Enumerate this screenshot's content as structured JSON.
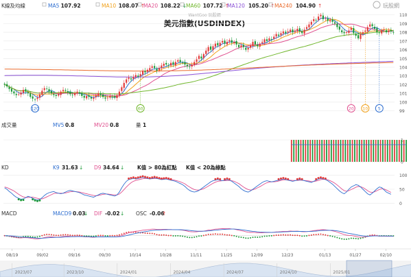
{
  "brand": {
    "text": "玩股網",
    "color": "#9b9b9b"
  },
  "title": "美元指數(USDINDEX)",
  "watermark": "WantGoo 玩股網",
  "legend": [
    {
      "label": "K線及均線",
      "value": "",
      "arrow": "",
      "color": "#333333"
    },
    {
      "label": "MA5",
      "value": "107.92",
      "arrow": "",
      "color": "#2f6fd0"
    },
    {
      "label": "MA10",
      "value": "108.07",
      "arrow": "↑",
      "color": "#f0a01a"
    },
    {
      "label": "MA20",
      "value": "108.22",
      "arrow": "↓",
      "color": "#e0508f"
    },
    {
      "label": "MA60",
      "value": "107.72",
      "arrow": "↑",
      "color": "#6fb62a"
    },
    {
      "label": "MA120",
      "value": "105.20",
      "arrow": "↑",
      "color": "#8a4fd6"
    },
    {
      "label": "MA240",
      "value": "104.90",
      "arrow": "↑",
      "color": "#ea6a2a"
    }
  ],
  "colors": {
    "up": "#e23b3b",
    "down": "#1f9a3a",
    "grid": "#e7e7e7",
    "axis": "#555555"
  },
  "chart_data": [
    {
      "id": "price",
      "type": "candlestick",
      "title": "美元指數(USDINDEX)",
      "yticks": [
        99,
        100,
        101,
        102,
        103,
        104,
        105,
        106,
        107,
        108,
        109,
        110
      ],
      "ylim": [
        98.5,
        110.6
      ],
      "closes": [
        102.0,
        101.8,
        101.5,
        101.2,
        101.0,
        100.8,
        100.9,
        101.1,
        101.4,
        101.2,
        101.0,
        100.6,
        100.4,
        100.3,
        100.5,
        100.9,
        101.3,
        101.6,
        101.5,
        101.2,
        101.0,
        100.8,
        100.7,
        100.9,
        101.2,
        101.4,
        101.3,
        101.1,
        100.9,
        100.8,
        101.0,
        101.2,
        101.0,
        100.7,
        100.5,
        100.7,
        100.6,
        100.4,
        100.5,
        100.8,
        101.0,
        100.8,
        100.6,
        100.4,
        100.5,
        100.7,
        100.6,
        100.5,
        100.8,
        101.2,
        101.7,
        102.2,
        102.6,
        102.8,
        102.6,
        102.9,
        103.1,
        102.9,
        103.2,
        103.6,
        103.4,
        103.7,
        103.9,
        104.1,
        103.9,
        103.6,
        103.9,
        104.2,
        104.4,
        104.3,
        104.2,
        104.5,
        104.3,
        104.6,
        104.8,
        104.6,
        104.5,
        104.3,
        104.1,
        104.0,
        104.3,
        104.6,
        104.9,
        105.3,
        105.0,
        105.5,
        105.9,
        106.3,
        106.0,
        106.4,
        106.7,
        106.5,
        106.8,
        107.0,
        106.7,
        106.9,
        107.1,
        106.8,
        106.9,
        106.6,
        106.3,
        106.5,
        106.3,
        106.0,
        106.2,
        106.5,
        106.9,
        106.6,
        106.4,
        106.7,
        106.9,
        107.2,
        107.0,
        107.3,
        107.2,
        107.5,
        107.8,
        107.6,
        107.9,
        108.1,
        107.9,
        108.1,
        108.3,
        108.0,
        108.2,
        108.4,
        108.1,
        107.9,
        108.3,
        108.6,
        108.9,
        109.2,
        109.5,
        109.4,
        109.8,
        110.0,
        109.5,
        109.6,
        109.3,
        109.4,
        109.2,
        109.0,
        108.6,
        108.3,
        108.0,
        107.9,
        108.0,
        108.2,
        108.5,
        107.9,
        107.6,
        107.3,
        107.8,
        108.0,
        108.2,
        108.6,
        108.9,
        108.7,
        108.4,
        108.0,
        107.9,
        108.2,
        108.3,
        108.0,
        108.2,
        108.1,
        108.0
      ],
      "ma_lines": [
        {
          "name": "MA5",
          "period": 5,
          "color": "#2f6fd0"
        },
        {
          "name": "MA10",
          "period": 10,
          "color": "#f0a01a"
        },
        {
          "name": "MA20",
          "period": 20,
          "color": "#e0508f"
        },
        {
          "name": "MA60",
          "period": 60,
          "color": "#6fb62a"
        },
        {
          "name": "MA120",
          "period": 120,
          "color": "#8a4fd6"
        },
        {
          "name": "MA240",
          "period": 240,
          "color": "#ea6a2a"
        }
      ],
      "markers": [
        {
          "label": "120",
          "index": 13,
          "color": "#2f6fd0"
        },
        {
          "label": "60",
          "index": 58,
          "color": "#6fb62a"
        },
        {
          "label": "20",
          "index": 148,
          "color": "#e0508f"
        },
        {
          "label": "10",
          "index": 154,
          "color": "#f0a01a"
        },
        {
          "label": "5",
          "index": 160,
          "color": "#2f6fd0"
        }
      ]
    },
    {
      "id": "volume",
      "type": "bar",
      "panel_label": "成交量",
      "mv5_label": "MV5",
      "mv5_value": "0.8",
      "mv20_label": "MV20",
      "mv20_value": "0.8",
      "qty_label": "量",
      "qty_value": "1",
      "yticks": [
        0,
        1
      ],
      "ylim": [
        0,
        1.25
      ],
      "start_index": 122,
      "values": [
        1,
        1,
        1,
        1,
        1,
        1,
        1,
        1,
        1,
        1,
        1,
        1,
        1,
        1,
        1,
        1,
        1,
        1,
        1,
        1,
        1,
        1,
        1,
        1,
        1,
        1,
        1,
        1,
        1,
        1,
        1,
        1,
        1,
        1,
        1,
        1,
        1,
        1,
        1,
        1,
        1,
        1,
        1,
        1,
        1,
        1,
        1,
        1,
        1,
        1
      ]
    },
    {
      "id": "kd",
      "type": "line",
      "panel_label": "KD",
      "k_label": "K9",
      "k_value": "31.63",
      "k_arrow": "↓",
      "d_label": "D9",
      "d_value": "34.64",
      "d_arrow": "↓",
      "note1": "K值 > 80為紅點",
      "note2": "K值 < 20為綠點",
      "yticks": [
        0,
        50,
        100
      ],
      "ylim": [
        -8,
        108
      ],
      "k": [
        55,
        50,
        42,
        36,
        28,
        22,
        18,
        15,
        16,
        20,
        25,
        22,
        18,
        14,
        12,
        14,
        20,
        28,
        34,
        38,
        40,
        42,
        38,
        36,
        34,
        36,
        40,
        44,
        46,
        44,
        42,
        40,
        38,
        34,
        30,
        28,
        26,
        24,
        22,
        26,
        30,
        34,
        36,
        34,
        32,
        30,
        28,
        26,
        30,
        40,
        55,
        68,
        78,
        84,
        86,
        88,
        86,
        88,
        90,
        92,
        90,
        88,
        86,
        88,
        90,
        88,
        86,
        84,
        85,
        86,
        84,
        82,
        80,
        78,
        74,
        70,
        66,
        60,
        52,
        46,
        42,
        40,
        42,
        46,
        52,
        58,
        64,
        70,
        76,
        80,
        82,
        84,
        82,
        80,
        82,
        84,
        82,
        78,
        72,
        66,
        60,
        52,
        46,
        42,
        40,
        44,
        50,
        56,
        62,
        68,
        74,
        78,
        80,
        78,
        76,
        78,
        80,
        82,
        84,
        86,
        84,
        82,
        80,
        78,
        80,
        82,
        84,
        82,
        80,
        78,
        76,
        74,
        78,
        82,
        86,
        88,
        86,
        84,
        80,
        74,
        68,
        60,
        52,
        44,
        38,
        34,
        40,
        50,
        58,
        62,
        66,
        64,
        58,
        50,
        42,
        34,
        30,
        36,
        44,
        52,
        58,
        56,
        48,
        40,
        36,
        32
      ],
      "d": [
        58,
        56,
        52,
        48,
        44,
        38,
        32,
        27,
        23,
        21,
        21,
        22,
        22,
        20,
        18,
        16,
        16,
        19,
        23,
        27,
        31,
        35,
        36,
        36,
        36,
        36,
        37,
        39,
        41,
        42,
        42,
        41,
        40,
        38,
        36,
        34,
        32,
        30,
        28,
        27,
        28,
        30,
        32,
        33,
        33,
        32,
        31,
        30,
        30,
        33,
        40,
        49,
        58,
        66,
        73,
        78,
        81,
        83,
        85,
        87,
        88,
        88,
        87,
        87,
        88,
        88,
        87,
        86,
        86,
        86,
        85,
        84,
        83,
        81,
        79,
        76,
        73,
        69,
        63,
        58,
        53,
        49,
        47,
        47,
        49,
        52,
        56,
        61,
        66,
        71,
        75,
        78,
        79,
        80,
        80,
        81,
        81,
        80,
        78,
        74,
        70,
        64,
        58,
        53,
        49,
        47,
        48,
        51,
        55,
        59,
        64,
        69,
        73,
        75,
        76,
        76,
        77,
        79,
        81,
        83,
        83,
        83,
        82,
        81,
        81,
        81,
        82,
        82,
        81,
        80,
        79,
        77,
        77,
        79,
        81,
        84,
        85,
        85,
        83,
        80,
        76,
        71,
        65,
        58,
        51,
        45,
        43,
        45,
        49,
        53,
        57,
        60,
        59,
        56,
        51,
        45,
        40,
        39,
        41,
        45,
        49,
        52,
        51,
        47,
        43,
        39
      ],
      "k_color": "#2f6fd0",
      "d_color": "#e0508f"
    },
    {
      "id": "macd",
      "type": "bar",
      "panel_label": "MACD",
      "macd_label": "MACD9",
      "macd_value": "0.03",
      "macd_arrow": "↓",
      "dif_label": "DIF",
      "dif_value": "-0.02",
      "dif_arrow": "↓",
      "osc_label": "OSC",
      "osc_value": "-0.06",
      "osc_arrow": "↑",
      "ylim": [
        -1.3,
        1.5
      ],
      "dif_color": "#e0508f",
      "macd_color": "#2f6fd0"
    }
  ],
  "x_axis": {
    "date_ticks": [
      {
        "label": "08/19",
        "index": 6
      },
      {
        "label": "09/02",
        "index": 27
      },
      {
        "label": "09/16",
        "index": 49
      },
      {
        "label": "09/30",
        "index": 70
      },
      {
        "label": "10/14",
        "index": 91
      },
      {
        "label": "10/28",
        "index": 112
      },
      {
        "label": "11/11",
        "index": 133
      },
      {
        "label": "11/25",
        "index": 154
      },
      {
        "label": "12/09",
        "index": 175
      },
      {
        "label": "12/23",
        "index": 196
      },
      {
        "label": "01/13",
        "index": 222
      },
      {
        "label": "01/27",
        "index": 243
      },
      {
        "label": "02/10",
        "index": 264
      }
    ],
    "scroll_labels": [
      {
        "label": "2023/07",
        "index": 8
      },
      {
        "label": "2023/10",
        "index": 42
      },
      {
        "label": "2024/01",
        "index": 77
      },
      {
        "label": "2024/04",
        "index": 112
      },
      {
        "label": "2024/07",
        "index": 147
      },
      {
        "label": "2024/10",
        "index": 182
      },
      {
        "label": "2025/01",
        "index": 217
      }
    ]
  }
}
